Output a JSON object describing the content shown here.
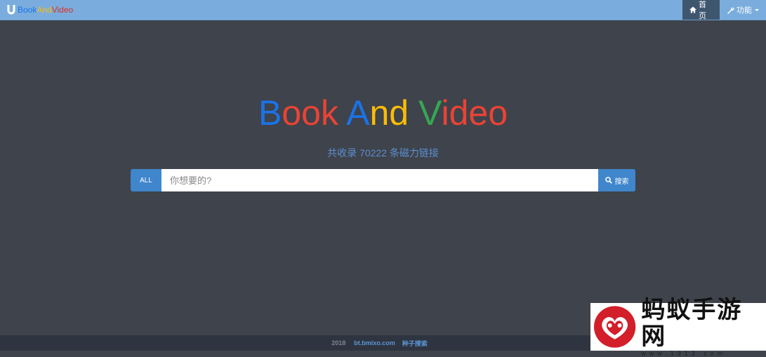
{
  "navbar": {
    "brand_parts": [
      "Book",
      "And",
      "Video"
    ],
    "items": [
      {
        "label": "首页",
        "icon": "home-icon"
      },
      {
        "label": "功能",
        "icon": "wrench-icon"
      }
    ]
  },
  "hero": {
    "title_letters": [
      {
        "ch": "B",
        "color": "#1a73e8"
      },
      {
        "ch": "o",
        "color": "#ea4335"
      },
      {
        "ch": "o",
        "color": "#ea4335"
      },
      {
        "ch": "k",
        "color": "#ea4335"
      },
      {
        "ch": " ",
        "color": "#ffffff"
      },
      {
        "ch": "A",
        "color": "#1a73e8"
      },
      {
        "ch": "n",
        "color": "#fbbc05"
      },
      {
        "ch": "d",
        "color": "#fbbc05"
      },
      {
        "ch": " ",
        "color": "#ffffff"
      },
      {
        "ch": "V",
        "color": "#34a853"
      },
      {
        "ch": "i",
        "color": "#ea4335"
      },
      {
        "ch": "d",
        "color": "#ea4335"
      },
      {
        "ch": "e",
        "color": "#ea4335"
      },
      {
        "ch": "o",
        "color": "#ea4335"
      }
    ],
    "subtitle": "共收录 70222 条磁力链接"
  },
  "search": {
    "scope_label": "ALL",
    "placeholder": "你想要的?",
    "value": "",
    "button_label": "搜索",
    "button_icon": "search-icon"
  },
  "footer": {
    "year": "2018",
    "site": "bt.bmixo.com",
    "link": "种子搜索"
  },
  "watermark": {
    "title": "蚂蚁手游网",
    "url": "www.1913.com"
  },
  "colors": {
    "navbar": "#7aaddd",
    "background": "#3f434b",
    "accent": "#3f86cc",
    "footer": "#2f3540"
  }
}
